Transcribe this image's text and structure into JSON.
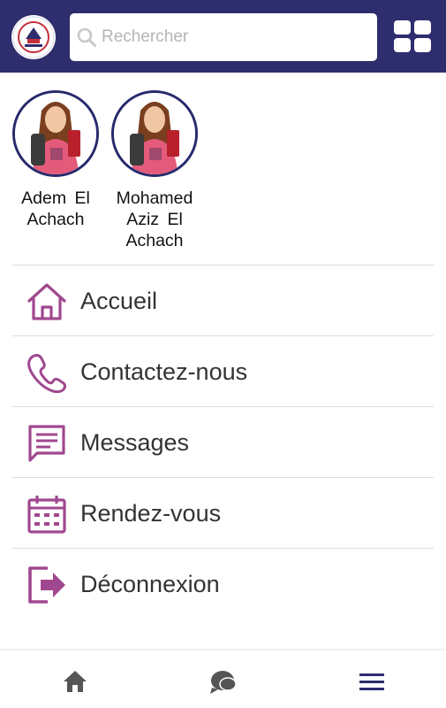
{
  "header": {
    "search_placeholder": "Rechercher",
    "logo_icon": "school-logo",
    "apps_icon": "grid-icon"
  },
  "children": [
    {
      "name": "Adem  El Achach"
    },
    {
      "name": "Mohamed Aziz  El Achach"
    }
  ],
  "menu": [
    {
      "label": "Accueil",
      "icon": "home-outline-icon"
    },
    {
      "label": "Contactez-nous",
      "icon": "phone-icon"
    },
    {
      "label": "Messages",
      "icon": "message-icon"
    },
    {
      "label": "Rendez-vous",
      "icon": "calendar-icon"
    },
    {
      "label": "Déconnexion",
      "icon": "logout-icon"
    }
  ],
  "bottom_nav": [
    {
      "icon": "home-icon"
    },
    {
      "icon": "chat-icon"
    },
    {
      "icon": "menu-icon"
    }
  ],
  "colors": {
    "header_bg": "#2e2d6e",
    "accent": "#a0488f",
    "avatar_border": "#262a6b",
    "nav_icon": "#555555",
    "menu_nav_icon": "#2e2d6e"
  }
}
